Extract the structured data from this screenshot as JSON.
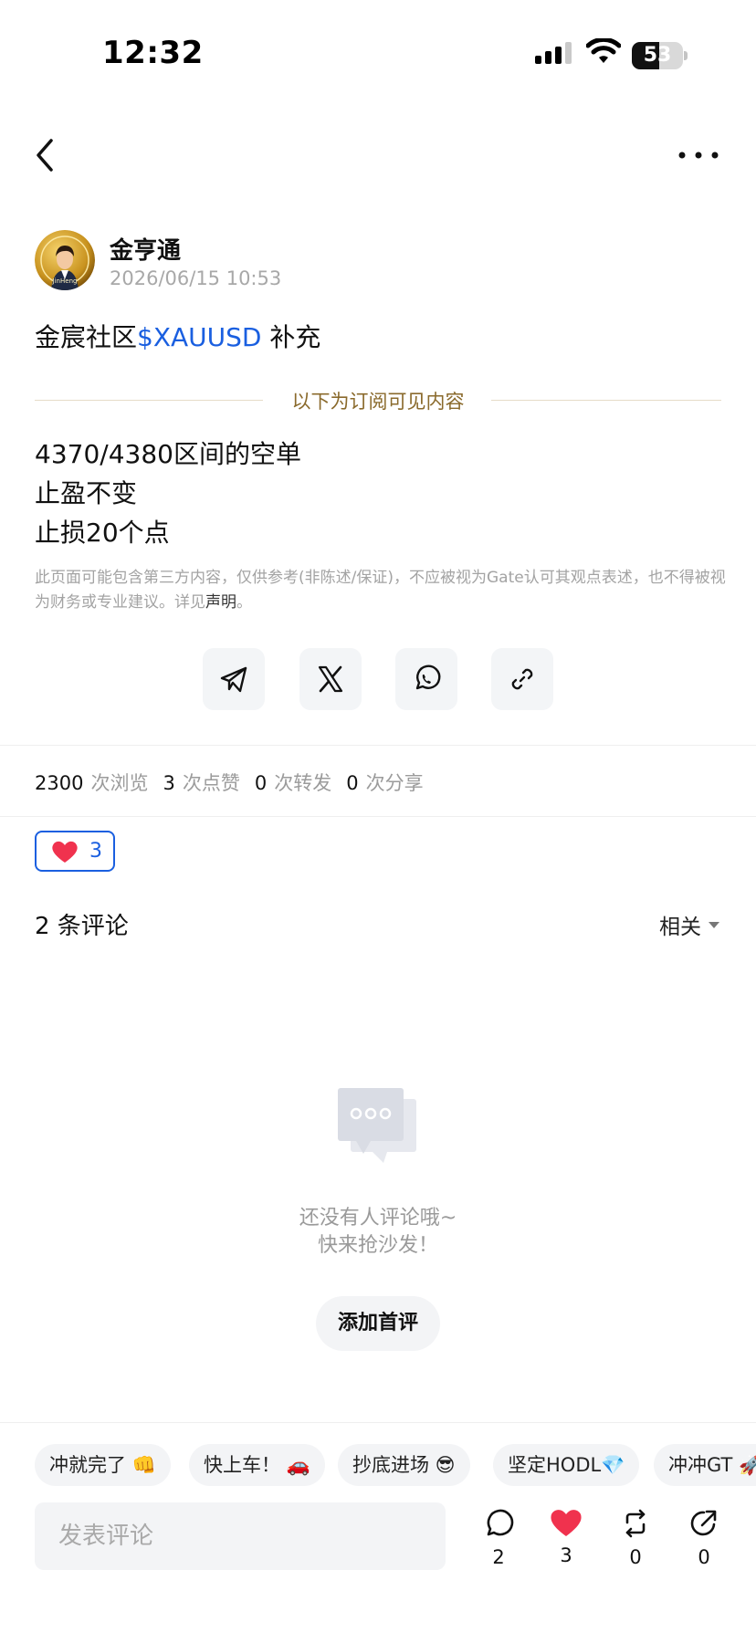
{
  "status_bar": {
    "time": "12:32",
    "battery": "53",
    "battery_level": 0.53
  },
  "author": {
    "name": "金亨通",
    "time": "2026/06/15 10:53",
    "avatar_text": "JinHeng"
  },
  "post": {
    "title_prefix": "金宸社区",
    "title_tag": "$XAUUSD",
    "title_suffix": " 补充",
    "subscriber_divider": "以下为订阅可见内容",
    "body_lines": [
      "4370/4380区间的空单",
      "止盈不变",
      "止损20个点"
    ],
    "disclaimer_text": "此页面可能包含第三方内容，仅供参考(非陈述/保证)，不应被视为Gate认可其观点表述，也不得被视为财务或专业建议。详见",
    "disclaimer_link": "声明",
    "disclaimer_end": "。"
  },
  "share": {
    "buttons": [
      {
        "icon": "telegram-icon"
      },
      {
        "icon": "x-icon"
      },
      {
        "icon": "whatsapp-icon"
      },
      {
        "icon": "link-icon"
      }
    ]
  },
  "stats": {
    "views": "2300",
    "views_label": "次浏览",
    "likes": "3",
    "likes_label": "次点赞",
    "reposts": "0",
    "reposts_label": "次转发",
    "shares": "0",
    "shares_label": "次分享"
  },
  "reaction": {
    "icon": "heart-icon",
    "count": "3"
  },
  "comments": {
    "title": "2 条评论",
    "sort": "相关",
    "empty_line1": "还没有人评论哦~",
    "empty_line2": "快来抢沙发！",
    "add_first": "添加首评"
  },
  "quick_replies": [
    "冲就完了 👊",
    "快上车！ 🚗",
    "抄底进场 😎",
    "坚定HODL💎",
    "冲冲GT 🚀"
  ],
  "bottom_bar": {
    "input_placeholder": "发表评论",
    "comments_count": "2",
    "likes_count": "3",
    "reposts_count": "0",
    "shares_count": "0"
  },
  "colors": {
    "accent": "#1a5fe0",
    "gold": "#8a6a2c",
    "heart": "#f0324e"
  }
}
